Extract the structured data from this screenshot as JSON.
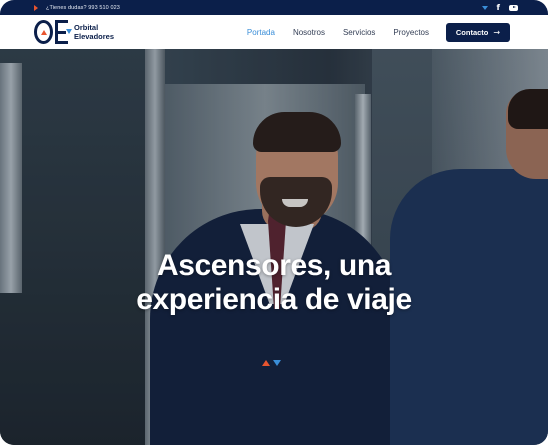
{
  "topbar": {
    "phone_text": "¿Tienes dudas? 993 510 023"
  },
  "brand": {
    "name_line1": "Orbital",
    "name_line2": "Elevadores"
  },
  "nav": {
    "items": [
      {
        "label": "Portada",
        "active": true
      },
      {
        "label": "Nosotros",
        "active": false
      },
      {
        "label": "Servicios",
        "active": false
      },
      {
        "label": "Proyectos",
        "active": false
      }
    ],
    "contact_label": "Contacto"
  },
  "hero": {
    "title_line1": "Ascensores, una",
    "title_line2": "experiencia de viaje"
  },
  "icons": {
    "facebook": "facebook-icon",
    "youtube": "youtube-icon",
    "phone": "phone-arrow-icon",
    "scroll": "scroll-arrows-icon"
  },
  "colors": {
    "navy": "#0b1f4a",
    "accent_blue": "#3a8ed8",
    "accent_orange": "#e8552f"
  }
}
